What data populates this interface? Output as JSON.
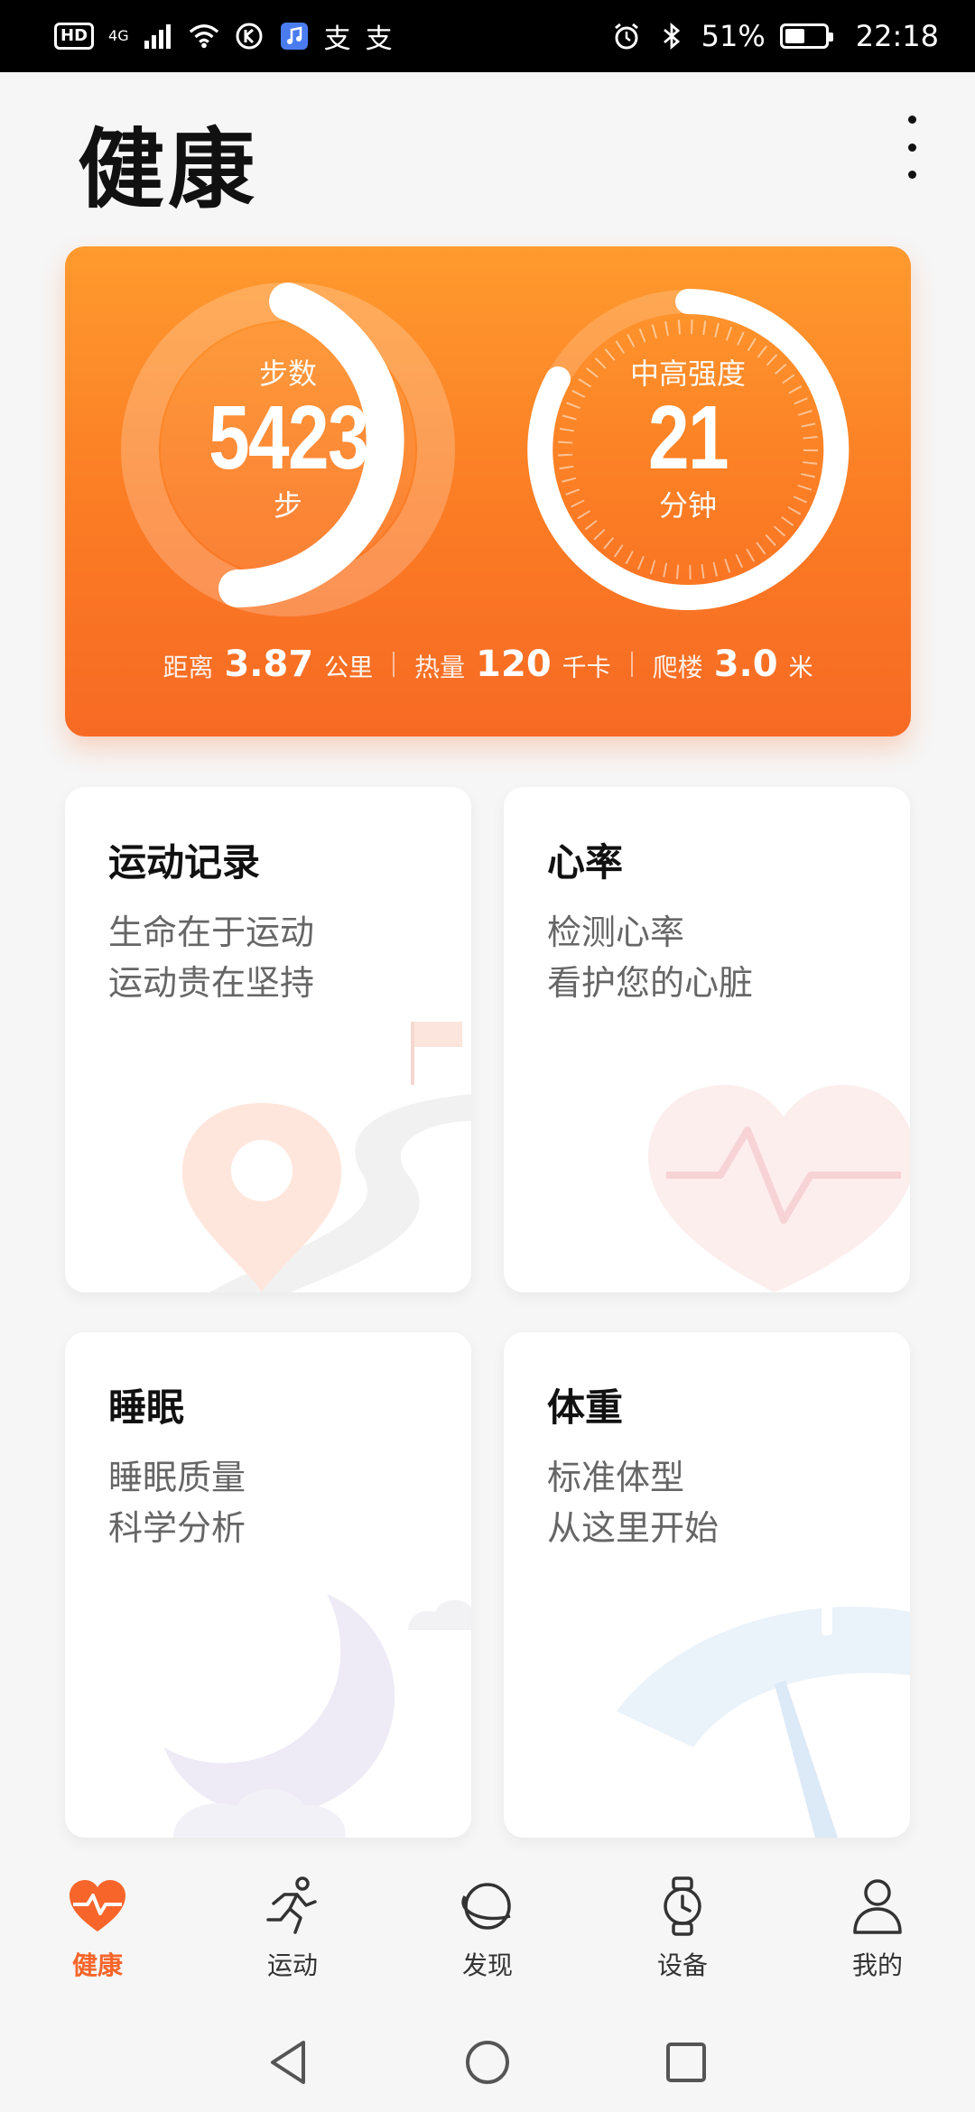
{
  "status_bar": {
    "left_badges": [
      "HD",
      "4G"
    ],
    "app_glyphs": [
      "支",
      "支"
    ],
    "battery_percent": "51%",
    "battery_level": 0.51,
    "time": "22:18"
  },
  "header": {
    "title": "健康"
  },
  "activity": {
    "steps": {
      "label": "步数",
      "value": "5423",
      "unit": "步"
    },
    "intensity": {
      "label": "中高强度",
      "value": "21",
      "unit": "分钟"
    },
    "stats": [
      {
        "label": "距离",
        "value": "3.87",
        "unit": "公里"
      },
      {
        "label": "热量",
        "value": "120",
        "unit": "千卡"
      },
      {
        "label": "爬楼",
        "value": "3.0",
        "unit": "米"
      }
    ]
  },
  "cards": [
    {
      "title": "运动记录",
      "line1": "生命在于运动",
      "line2": "运动贵在坚持"
    },
    {
      "title": "心率",
      "line1": "检测心率",
      "line2": "看护您的心脏"
    },
    {
      "title": "睡眠",
      "line1": "睡眠质量",
      "line2": "科学分析"
    },
    {
      "title": "体重",
      "line1": "标准体型",
      "line2": "从这里开始"
    }
  ],
  "nav": [
    {
      "label": "健康",
      "icon": "heart-pulse-icon",
      "active": true
    },
    {
      "label": "运动",
      "icon": "running-person-icon",
      "active": false
    },
    {
      "label": "发现",
      "icon": "planet-icon",
      "active": false
    },
    {
      "label": "设备",
      "icon": "watch-icon",
      "active": false
    },
    {
      "label": "我的",
      "icon": "person-icon",
      "active": false
    }
  ],
  "colors": {
    "accent": "#f7652a",
    "card_gradient_top": "#ff9a2e",
    "card_gradient_bottom": "#f76a24"
  }
}
